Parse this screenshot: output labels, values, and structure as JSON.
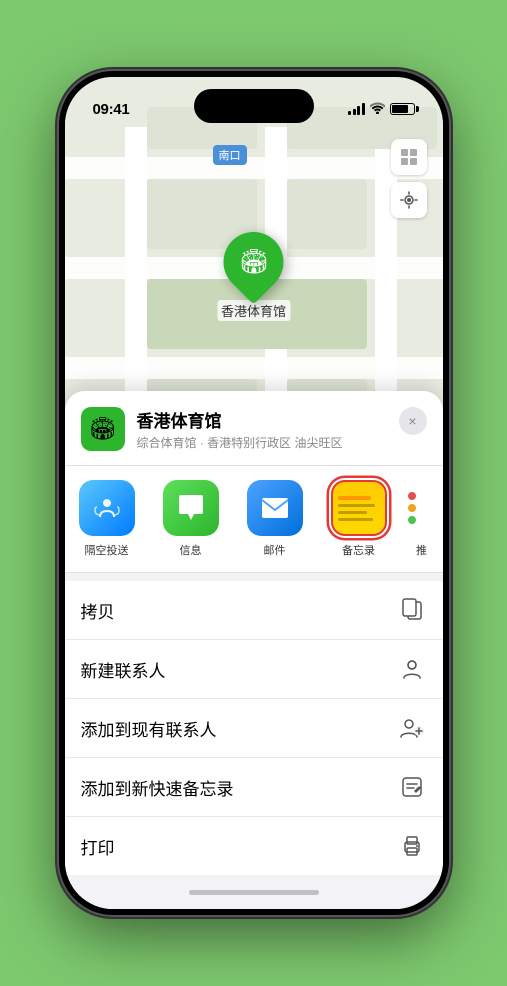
{
  "statusBar": {
    "time": "09:41",
    "hasLocation": true
  },
  "map": {
    "label": "南口",
    "pinLabel": "香港体育馆"
  },
  "venue": {
    "name": "香港体育馆",
    "description": "综合体育馆 · 香港特别行政区 油尖旺区",
    "closeLabel": "×"
  },
  "shareApps": [
    {
      "id": "airdrop",
      "label": "隔空投送"
    },
    {
      "id": "messages",
      "label": "信息"
    },
    {
      "id": "mail",
      "label": "邮件"
    },
    {
      "id": "notes",
      "label": "备忘录",
      "selected": true
    },
    {
      "id": "more",
      "label": "推"
    }
  ],
  "actions": [
    {
      "label": "拷贝",
      "icon": "copy"
    },
    {
      "label": "新建联系人",
      "icon": "person"
    },
    {
      "label": "添加到现有联系人",
      "icon": "person-add"
    },
    {
      "label": "添加到新快速备忘录",
      "icon": "note"
    },
    {
      "label": "打印",
      "icon": "print"
    }
  ]
}
